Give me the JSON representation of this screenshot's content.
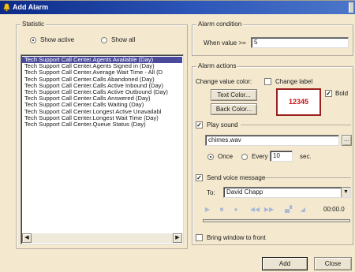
{
  "window": {
    "title": "Add Alarm"
  },
  "statistic": {
    "group_label": "Statistic",
    "show_active_label": "Show active",
    "show_all_label": "Show all",
    "selected_filter": "Show active",
    "items": [
      "Tech Support Call Center.Agents Available (Day)",
      "Tech Support Call Center.Agents Signed in (Day)",
      "Tech Support Call Center.Average Wait Time - All (D",
      "Tech Support Call Center.Calls Abandoned (Day)",
      "Tech Support Call Center.Calls Active Inbound (Day)",
      "Tech Support Call Center.Calls Active Outbound (Day)",
      "Tech Support Call Center.Calls Answered (Day)",
      "Tech Support Call Center.Calls Waiting (Day)",
      "Tech Support Call Center.Longest Active Unavailabl",
      "Tech Support Call Center.Longest Wait Time (Day)",
      "Tech Support Call Center.Queue Status (Day)"
    ],
    "selected_index": 0
  },
  "alarm_condition": {
    "group_label": "Alarm condition",
    "when_label": "When value >=",
    "value": "5"
  },
  "alarm_actions": {
    "group_label": "Alarm actions",
    "change_value_color_label": "Change value color:",
    "change_label_label": "Change label",
    "change_label_checked": false,
    "text_color_button": "Text Color...",
    "back_color_button": "Back Color...",
    "sample_value": "12345",
    "sample_color": "#cc1111",
    "bold_label": "Bold",
    "bold_checked": true,
    "play_sound_label": "Play sound",
    "play_sound_checked": true,
    "sound_file": "chimes.wav",
    "browse_button": "...",
    "once_label": "Once",
    "every_label": "Every",
    "repeat_mode": "Once",
    "every_value": "10",
    "sec_label": "sec.",
    "send_voice_label": "Send voice message",
    "send_voice_checked": true,
    "to_label": "To:",
    "to_value": "David Chapp",
    "time_display": "00:00.0",
    "bring_to_front_label": "Bring window to front",
    "bring_to_front_checked": false
  },
  "footer": {
    "add_button": "Add",
    "close_button": "Close"
  }
}
